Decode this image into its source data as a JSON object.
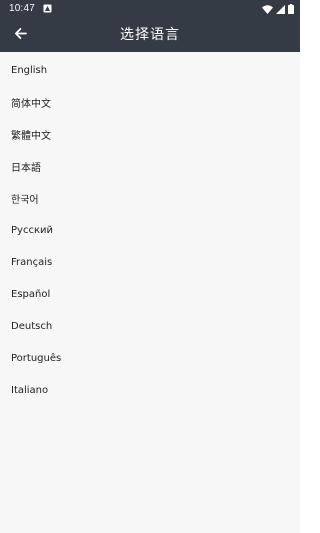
{
  "status_bar": {
    "time": "10:47",
    "icons": [
      "notification-icon",
      "wifi-icon",
      "signal-icon",
      "battery-icon"
    ]
  },
  "app_bar": {
    "title": "选择语言",
    "back_icon": "arrow-left-icon"
  },
  "languages": [
    {
      "label": "English"
    },
    {
      "label": "简体中文"
    },
    {
      "label": "繁體中文"
    },
    {
      "label": "日本語"
    },
    {
      "label": "한국어"
    },
    {
      "label": "Русский"
    },
    {
      "label": "Français"
    },
    {
      "label": "Español"
    },
    {
      "label": "Deutsch"
    },
    {
      "label": "Português"
    },
    {
      "label": "Italiano"
    }
  ],
  "colors": {
    "bar_background": "#353b44",
    "page_background": "#f7f7f7",
    "text": "#222222"
  }
}
